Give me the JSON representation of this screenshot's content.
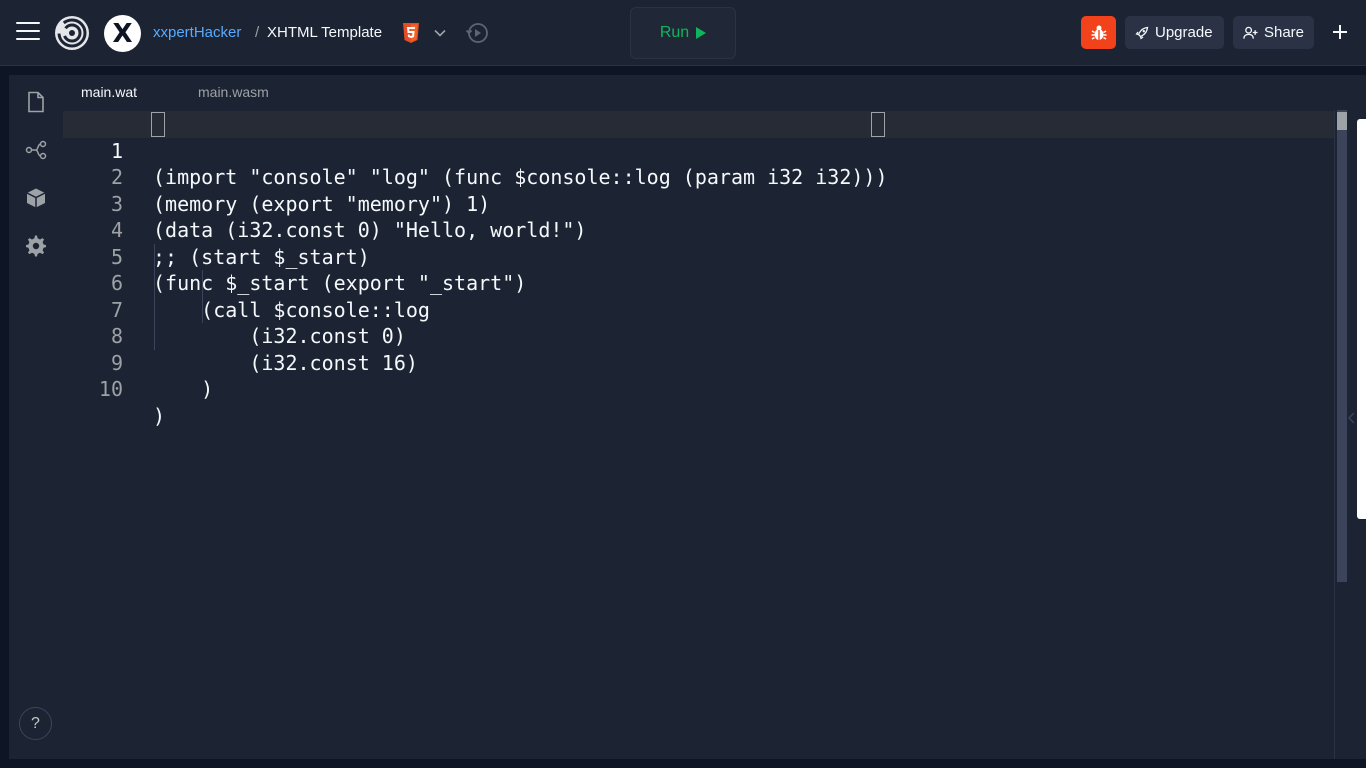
{
  "header": {
    "user": "xxpertHacker",
    "separator": "/",
    "repl_name": "XHTML Template",
    "run_label": "Run",
    "upgrade_label": "Upgrade",
    "share_label": "Share",
    "avatar_letter": "X"
  },
  "icons": {
    "menu": "hamburger-icon",
    "logo": "replit-logo",
    "language": "html5-icon",
    "dropdown": "chevron-down-icon",
    "history": "history-icon",
    "run": "play-icon",
    "debug": "bug-icon",
    "upgrade": "rocket-icon",
    "share": "add-user-icon",
    "add": "plus-icon",
    "files": "file-icon",
    "git": "git-branch-icon",
    "packages": "package-icon",
    "settings": "gear-icon"
  },
  "tabs": [
    {
      "label": "main.wat",
      "active": true
    },
    {
      "label": "main.wasm",
      "active": false
    }
  ],
  "editor": {
    "lines": [
      {
        "n": "1",
        "text": "(import \"console\" \"log\" (func $console::log (param i32 i32)))"
      },
      {
        "n": "2",
        "text": "(memory (export \"memory\") 1)"
      },
      {
        "n": "3",
        "text": "(data (i32.const 0) \"Hello, world!\")"
      },
      {
        "n": "4",
        "text": ";; (start $_start)"
      },
      {
        "n": "5",
        "text": "(func $_start (export \"_start\")"
      },
      {
        "n": "6",
        "text": "    (call $console::log"
      },
      {
        "n": "7",
        "text": "        (i32.const 0)"
      },
      {
        "n": "8",
        "text": "        (i32.const 16)"
      },
      {
        "n": "9",
        "text": "    )"
      },
      {
        "n": "10",
        "text": ")"
      }
    ]
  },
  "help_label": "?",
  "colors": {
    "background": "#0e1525",
    "surface": "#1c2333",
    "accent_link": "#57abff",
    "run_green": "#0fb55a",
    "debug_orange": "#f2421b",
    "html5_orange": "#e44d26"
  }
}
